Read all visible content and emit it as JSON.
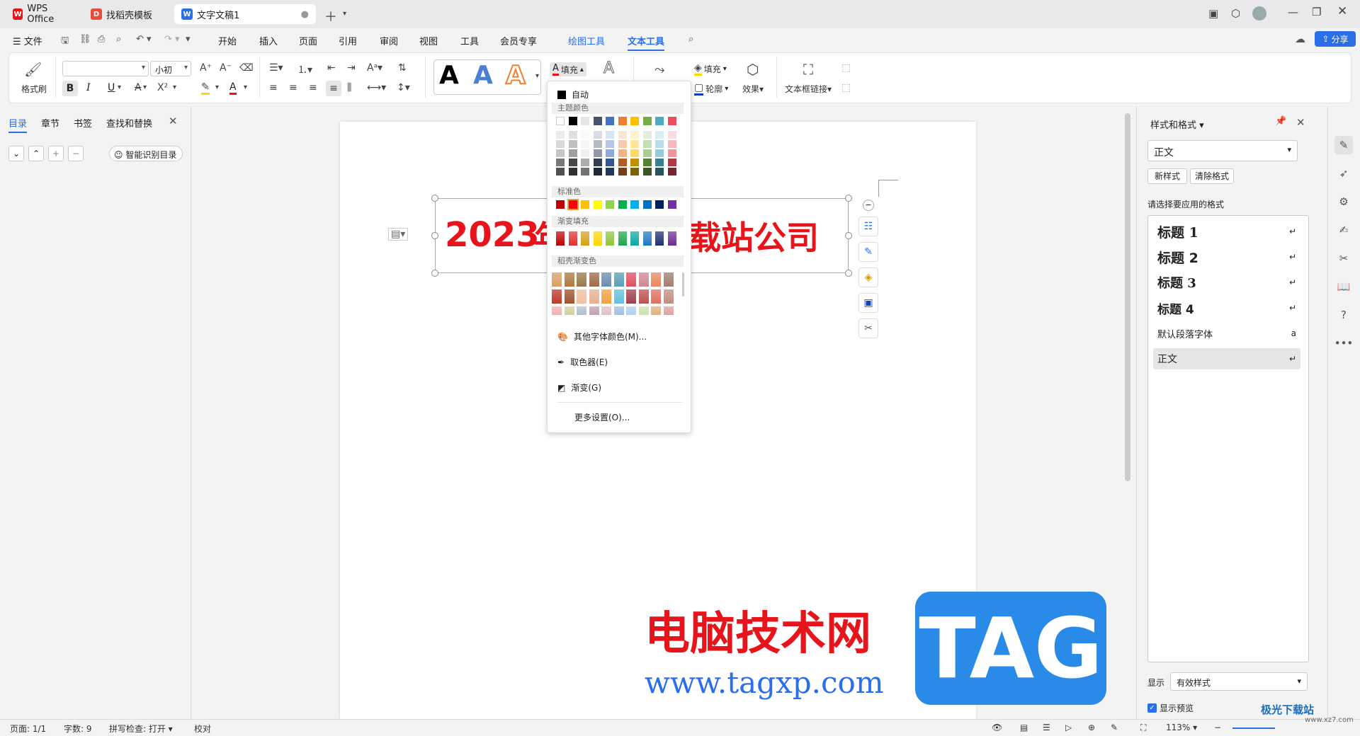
{
  "tabs": [
    {
      "label": "WPS Office",
      "logo": "W"
    },
    {
      "label": "找稻壳模板",
      "logo": "D"
    },
    {
      "label": "文字文稿1",
      "logo": "W"
    }
  ],
  "menu": {
    "file": "文件",
    "items": [
      "开始",
      "插入",
      "页面",
      "引用",
      "审阅",
      "视图",
      "工具",
      "会员专享"
    ],
    "drawing_tools": "绘图工具",
    "text_tools": "文本工具",
    "share": "分享"
  },
  "ribbon": {
    "format_painter": "格式刷",
    "font_size": "小初",
    "fill": "填充",
    "fill2": "填充",
    "outline": "轮廓",
    "effect": "效果",
    "textbox_link": "文本框链接",
    "bold": "B",
    "italic": "I",
    "underline": "U",
    "art_a": "A"
  },
  "left_panel": {
    "tabs": [
      "目录",
      "章节",
      "书签",
      "查找和替换"
    ],
    "smart_toc": "智能识别目录"
  },
  "document": {
    "text_visible_left": "2023",
    "text_visible_mid": "年",
    "text_visible_right": "载站公司",
    "text_color": "#e8141b"
  },
  "color_popup": {
    "auto": "自动",
    "theme_label": "主题颜色",
    "standard_label": "标准色",
    "gradient_label": "渐变填充",
    "docer_label": "稻壳渐变色",
    "more_colors": "其他字体颜色(M)...",
    "eyedropper": "取色器(E)",
    "gradient": "渐变(G)",
    "more_settings": "更多设置(O)...",
    "theme_top": [
      "#ffffff",
      "#000000",
      "#e7e6e6",
      "#44546a",
      "#4472c4",
      "#ed7d31",
      "#ffc000",
      "#70ad47",
      "#4bacc6",
      "#e84d60"
    ],
    "standard": [
      "#c00000",
      "#ff0000",
      "#ffc000",
      "#ffff00",
      "#92d050",
      "#00b050",
      "#00b0f0",
      "#0070c0",
      "#002060",
      "#7030a0"
    ],
    "gradient_fill": [
      "#c00000",
      "#e03030",
      "#d4a017",
      "#ffd700",
      "#8dc63f",
      "#1ea64a",
      "#0aa8a0",
      "#1f78c1",
      "#1b2f6e",
      "#6a2c91"
    ],
    "docer": [
      "#d9a066",
      "#b07840",
      "#9a7a4a",
      "#a06b4a",
      "#6b8fb0",
      "#5aa0b8",
      "#e05060",
      "#d08890",
      "#e88860",
      "#a08070"
    ],
    "docer2": [
      "#c0392b",
      "#a0522d",
      "#f0c0a0",
      "#e8b090",
      "#f0a040",
      "#60c0e0",
      "#a04050",
      "#c05050",
      "#e07060",
      "#c09080"
    ],
    "docer3": [
      "#f0b0b0",
      "#d0d0a0",
      "#b0c0d0",
      "#c0a0b0",
      "#e0c0c0",
      "#a0c0e0",
      "#b0d0f0",
      "#d0e0b0",
      "#e0b080",
      "#e0a0a0"
    ]
  },
  "right_panel": {
    "title": "样式和格式",
    "current": "正文",
    "new_style": "新样式",
    "clear_format": "清除格式",
    "choose": "请选择要应用的格式",
    "styles": [
      "标题 1",
      "标题 2",
      "标题 3",
      "标题 4",
      "默认段落字体",
      "正文"
    ],
    "display_label": "显示",
    "display_value": "有效样式",
    "preview": "显示预览"
  },
  "status": {
    "page": "页面: 1/1",
    "words": "字数: 9",
    "spell": "拼写检查: 打开",
    "proof": "校对",
    "zoom": "113%"
  },
  "watermark": {
    "site_cn": "电脑技术网",
    "site_url": "www.tagxp.com",
    "tag": "TAG",
    "corner": "极光下载站",
    "corner_url": "www.xz7.com"
  }
}
